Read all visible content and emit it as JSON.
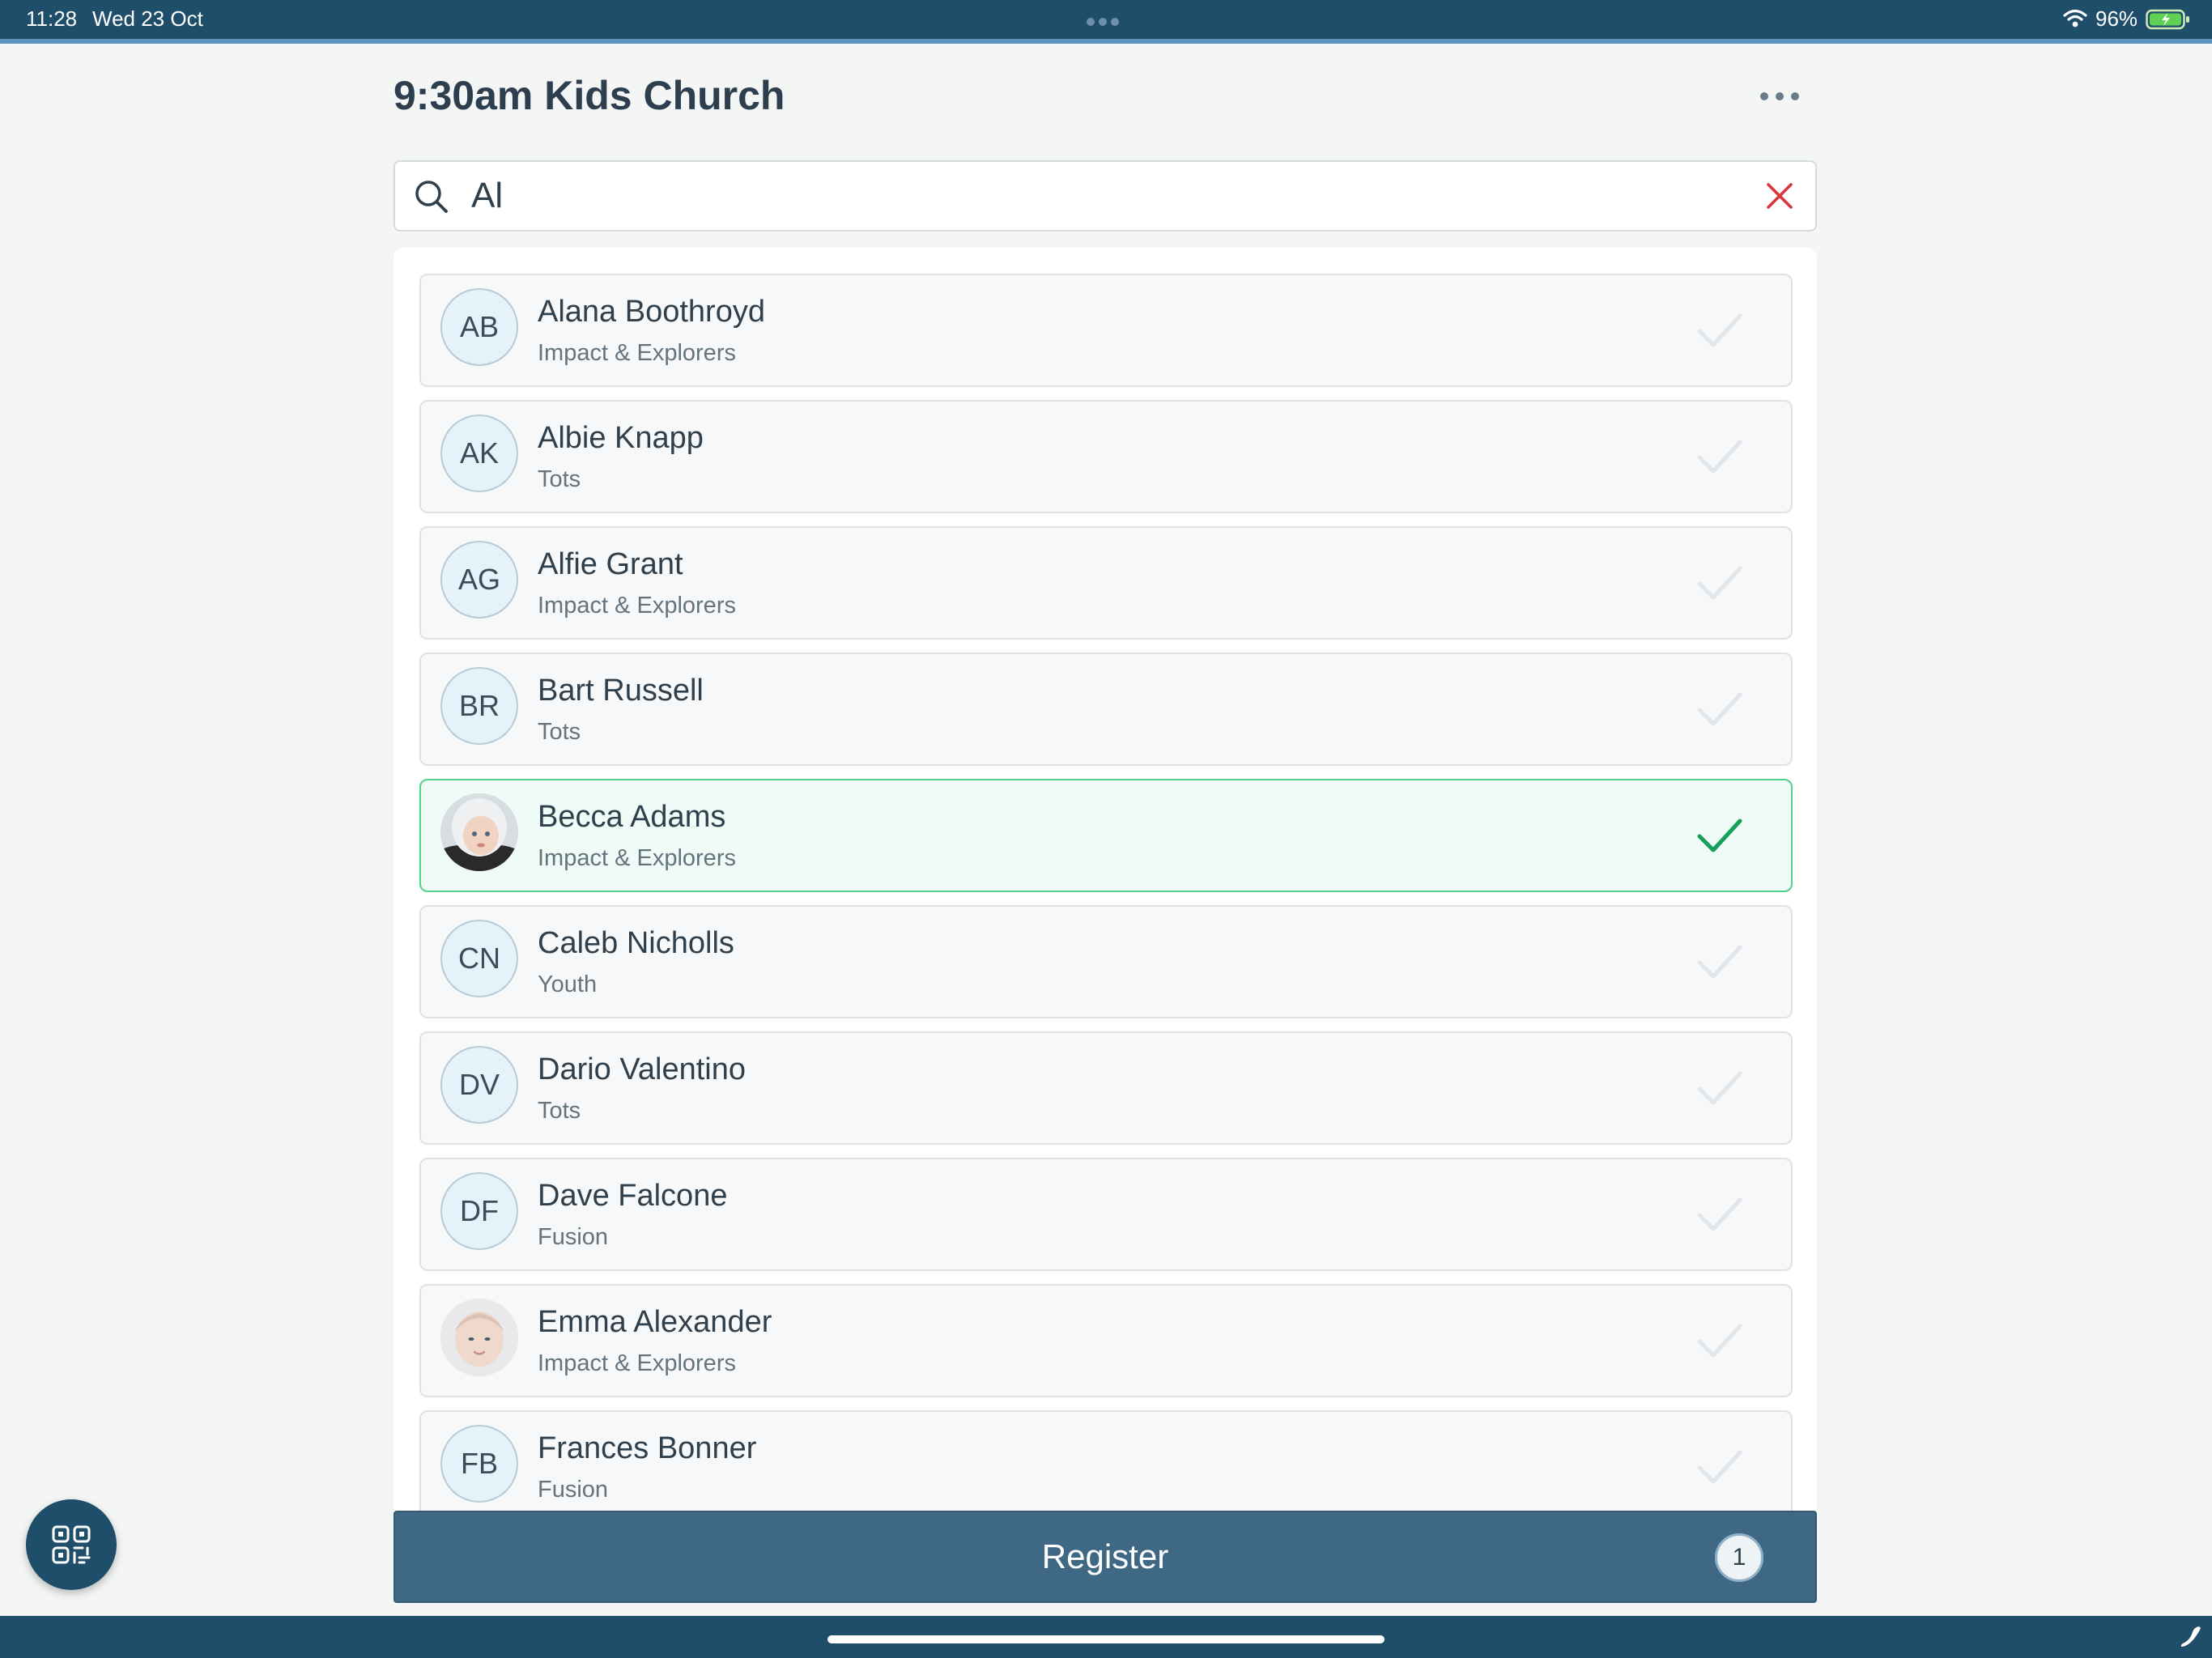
{
  "status_bar": {
    "time": "11:28",
    "date": "Wed 23 Oct",
    "battery": "96%",
    "icons": [
      "wifi-icon",
      "battery-charging-icon"
    ]
  },
  "header": {
    "title": "9:30am Kids Church",
    "more_icon": "ellipsis-icon"
  },
  "search": {
    "value": "Al",
    "placeholder": "",
    "clear_icon": "close-icon"
  },
  "people": [
    {
      "initials": "AB",
      "name": "Alana Boothroyd",
      "group": "Impact & Explorers",
      "selected": false,
      "photo": false
    },
    {
      "initials": "AK",
      "name": "Albie Knapp",
      "group": "Tots",
      "selected": false,
      "photo": false
    },
    {
      "initials": "AG",
      "name": "Alfie Grant",
      "group": "Impact & Explorers",
      "selected": false,
      "photo": false
    },
    {
      "initials": "BR",
      "name": "Bart Russell",
      "group": "Tots",
      "selected": false,
      "photo": false
    },
    {
      "initials": "",
      "name": "Becca Adams",
      "group": "Impact & Explorers",
      "selected": true,
      "photo": true
    },
    {
      "initials": "CN",
      "name": "Caleb Nicholls",
      "group": "Youth",
      "selected": false,
      "photo": false
    },
    {
      "initials": "DV",
      "name": "Dario Valentino",
      "group": "Tots",
      "selected": false,
      "photo": false
    },
    {
      "initials": "DF",
      "name": "Dave Falcone",
      "group": "Fusion",
      "selected": false,
      "photo": false
    },
    {
      "initials": "",
      "name": "Emma Alexander",
      "group": "Impact & Explorers",
      "selected": false,
      "photo": true
    },
    {
      "initials": "FB",
      "name": "Frances Bonner",
      "group": "Fusion",
      "selected": false,
      "photo": false
    }
  ],
  "register": {
    "label": "Register",
    "count": "1"
  },
  "qr_button": {
    "icon": "qr-code-icon"
  },
  "colors": {
    "primary": "#1f4e6b",
    "register": "#3f6884",
    "selected_border": "#54cf8d",
    "selected_check": "#16a05a",
    "clear_icon": "#d9363e"
  }
}
